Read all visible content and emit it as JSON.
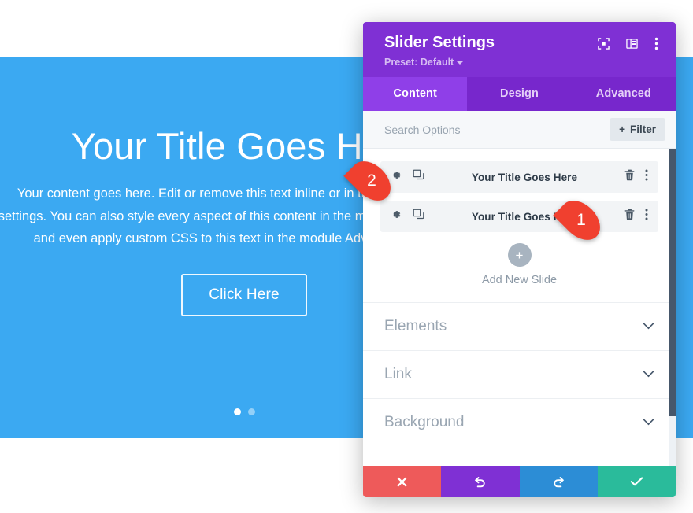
{
  "slider": {
    "title": "Your Title Goes Here",
    "body": "Your content goes here. Edit or remove this text inline or in the module Content settings. You can also style every aspect of this content in the module Design settings and even apply custom CSS to this text in the module Advanced settings.",
    "button_label": "Click Here",
    "dots": [
      {
        "name": "dot-1",
        "active": true
      },
      {
        "name": "dot-2",
        "active": false
      }
    ],
    "background_color": "#3ba9f2"
  },
  "modal": {
    "title": "Slider Settings",
    "preset_label": "Preset: Default",
    "header_color": "#7F30D4",
    "header_icons": [
      {
        "name": "expand-focus-icon",
        "label": "Expand"
      },
      {
        "name": "panel-layout-icon",
        "label": "Layout"
      },
      {
        "name": "more-vertical-icon",
        "label": "More"
      }
    ],
    "tabs": [
      {
        "label": "Content",
        "active": true
      },
      {
        "label": "Design",
        "active": false
      },
      {
        "label": "Advanced",
        "active": false
      }
    ],
    "search": {
      "placeholder": "Search Options",
      "value": ""
    },
    "filter_button": {
      "label": "Filter",
      "plus": "+"
    },
    "slides": [
      {
        "title": "Your Title Goes Here",
        "gear": "settings-icon",
        "duplicate": "duplicate-icon",
        "delete": "trash-icon",
        "menu": "more-vertical-icon"
      },
      {
        "title": "Your Title Goes Here",
        "gear": "settings-icon",
        "duplicate": "duplicate-icon",
        "delete": "trash-icon",
        "menu": "more-vertical-icon"
      }
    ],
    "add_slide": {
      "icon": "plus-icon",
      "label": "Add New Slide"
    },
    "accordions": [
      {
        "label": "Elements",
        "expanded": false
      },
      {
        "label": "Link",
        "expanded": false
      },
      {
        "label": "Background",
        "expanded": false
      }
    ],
    "footer_buttons": [
      {
        "name": "cancel-button",
        "icon": "close-icon",
        "color": "#EE5A5A"
      },
      {
        "name": "undo-button",
        "icon": "undo-icon",
        "color": "#7F30D4"
      },
      {
        "name": "redo-button",
        "icon": "redo-icon",
        "color": "#2C8DD6"
      },
      {
        "name": "save-button",
        "icon": "check-icon",
        "color": "#2ABB9B"
      }
    ]
  },
  "callouts": [
    {
      "number": "2",
      "target": "slide-1-gear"
    },
    {
      "number": "1",
      "target": "slide-2-delete"
    }
  ]
}
